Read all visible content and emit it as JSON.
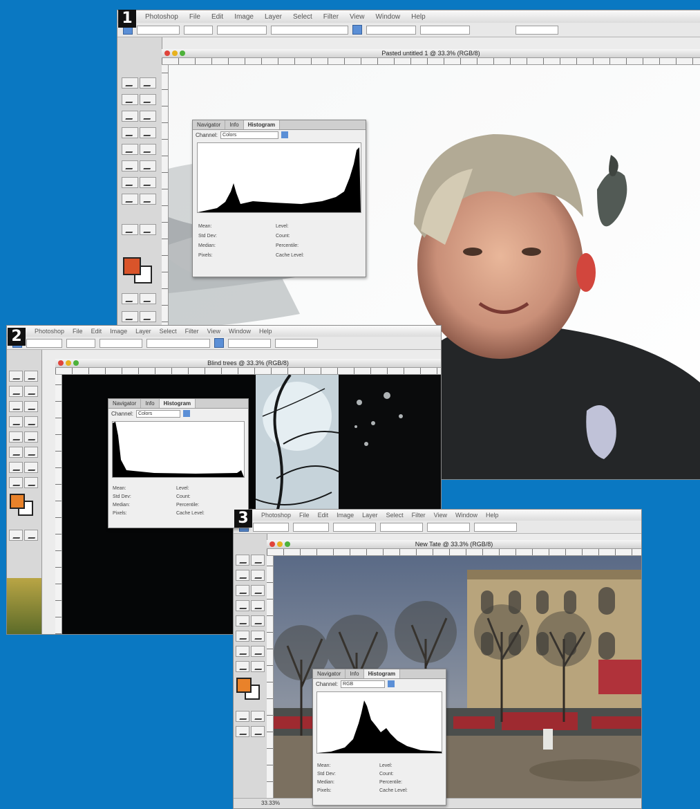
{
  "screens": [
    {
      "number": "1",
      "menu": [
        "Photoshop",
        "File",
        "Edit",
        "Image",
        "Layer",
        "Select",
        "Filter",
        "View",
        "Window",
        "Help"
      ],
      "doc_title": "Pasted untitled 1 @ 33.3% (RGB/8)",
      "histogram": {
        "tabs": [
          "Navigator",
          "Info",
          "Histogram"
        ],
        "channel_label": "Channel:",
        "channel_value": "Colors",
        "stats_left": [
          "Mean:",
          "Std Dev:",
          "Median:",
          "Pixels:"
        ],
        "stats_right": [
          "Level:",
          "Count:",
          "Percentile:",
          "Cache Level:"
        ]
      }
    },
    {
      "number": "2",
      "menu": [
        "Photoshop",
        "File",
        "Edit",
        "Image",
        "Layer",
        "Select",
        "Filter",
        "View",
        "Window",
        "Help"
      ],
      "doc_title": "Blind trees @ 33.3% (RGB/8)",
      "histogram": {
        "tabs": [
          "Navigator",
          "Info",
          "Histogram"
        ],
        "channel_label": "Channel:",
        "channel_value": "Colors",
        "stats_left": [
          "Mean:",
          "Std Dev:",
          "Median:",
          "Pixels:"
        ],
        "stats_right": [
          "Level:",
          "Count:",
          "Percentile:",
          "Cache Level:"
        ]
      }
    },
    {
      "number": "3",
      "menu": [
        "Photoshop",
        "File",
        "Edit",
        "Image",
        "Layer",
        "Select",
        "Filter",
        "View",
        "Window",
        "Help"
      ],
      "doc_title": "New Tate @ 33.3% (RGB/8)",
      "histogram": {
        "tabs": [
          "Navigator",
          "Info",
          "Histogram"
        ],
        "channel_label": "Channel:",
        "channel_value": "RGB",
        "stats_left": [
          "Mean:",
          "Std Dev:",
          "Median:",
          "Pixels:"
        ],
        "stats_right": [
          "Level:",
          "Count:",
          "Percentile:",
          "Cache Level:"
        ]
      },
      "status_zoom": "33.33%"
    }
  ],
  "colors": {
    "background": "#0a78c2",
    "foreground_swatch_1": "#d9542a",
    "foreground_swatch_2": "#e9822a",
    "foreground_swatch_3": "#e9822a"
  }
}
